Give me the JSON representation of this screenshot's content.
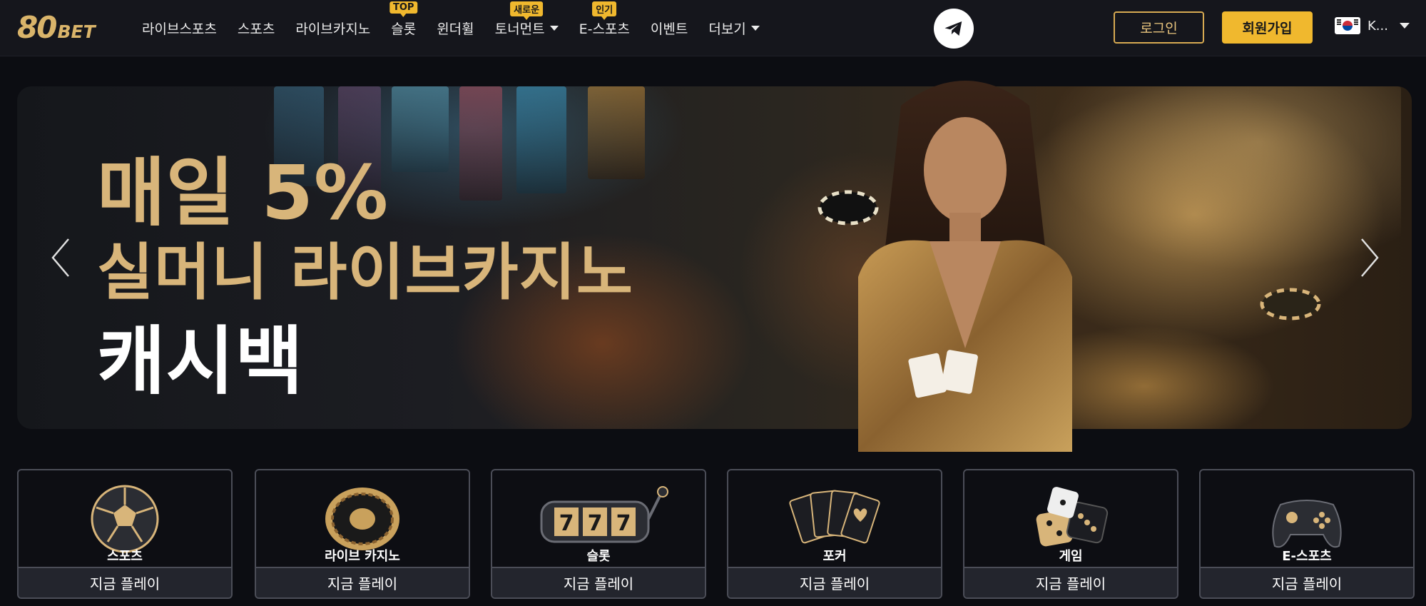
{
  "brand": {
    "logo_num": "80",
    "logo_text": "BET",
    "accent": "#f0b82e",
    "gold": "#d8b57a"
  },
  "nav": [
    {
      "label": "라이브스포츠",
      "badge": "",
      "caret": false
    },
    {
      "label": "스포츠",
      "badge": "",
      "caret": false
    },
    {
      "label": "라이브카지노",
      "badge": "",
      "caret": false
    },
    {
      "label": "슬롯",
      "badge": "TOP",
      "caret": false
    },
    {
      "label": "윈더휠",
      "badge": "",
      "caret": false
    },
    {
      "label": "토너먼트",
      "badge": "새로운",
      "caret": true
    },
    {
      "label": "E-스포츠",
      "badge": "인기",
      "caret": false
    },
    {
      "label": "이벤트",
      "badge": "",
      "caret": false
    },
    {
      "label": "더보기",
      "badge": "",
      "caret": true
    }
  ],
  "header": {
    "telegram_icon": "telegram-icon",
    "login_label": "로그인",
    "signup_label": "회원가입",
    "language_label": "K..."
  },
  "banner": {
    "line1": "매일 5%",
    "line2": "실머니 라이브카지노",
    "line3": "캐시백"
  },
  "tiles": [
    {
      "category": "스포츠",
      "cta": "지금 플레이",
      "icon": "soccer-ball-icon"
    },
    {
      "category": "라이브 카지노",
      "cta": "지금 플레이",
      "icon": "roulette-icon"
    },
    {
      "category": "슬롯",
      "cta": "지금 플레이",
      "icon": "slot-machine-icon"
    },
    {
      "category": "포커",
      "cta": "지금 플레이",
      "icon": "playing-cards-icon"
    },
    {
      "category": "게임",
      "cta": "지금 플레이",
      "icon": "dice-icon"
    },
    {
      "category": "E-스포츠",
      "cta": "지금 플레이",
      "icon": "gamepad-icon"
    }
  ]
}
